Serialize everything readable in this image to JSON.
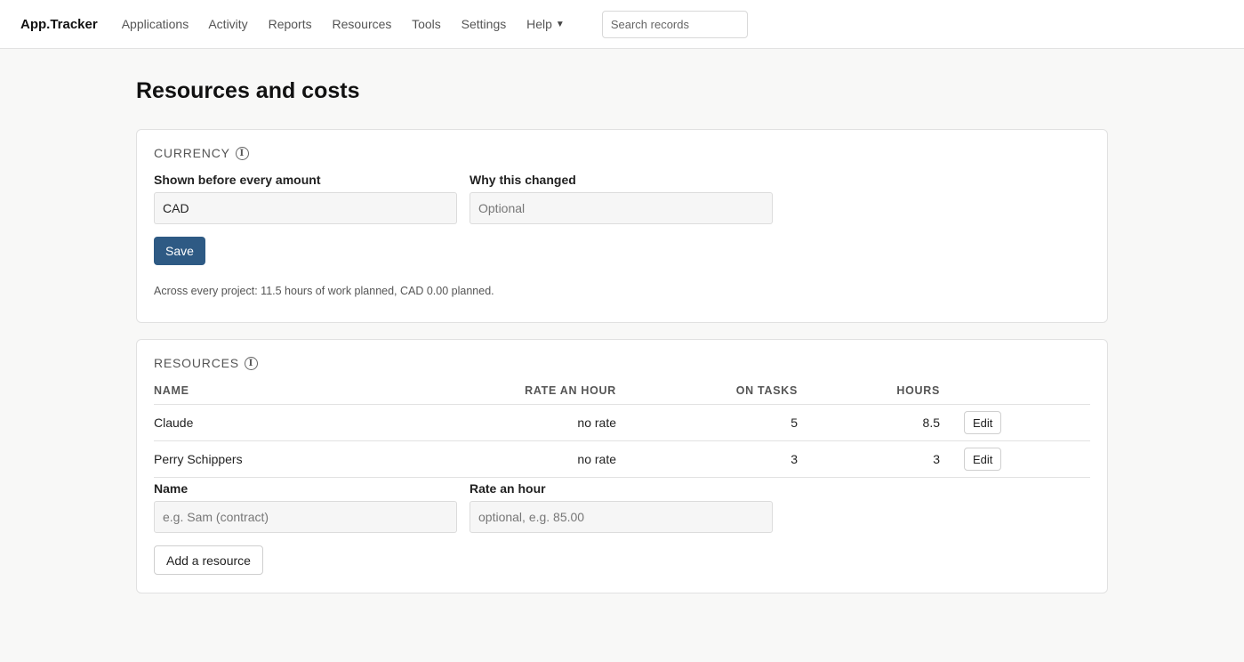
{
  "topbar": {
    "brand": "App.Tracker",
    "nav": [
      "Applications",
      "Activity",
      "Reports",
      "Resources",
      "Tools",
      "Settings"
    ],
    "help_label": "Help",
    "search_placeholder": "Search records"
  },
  "page": {
    "title": "Resources and costs"
  },
  "currency": {
    "heading": "CURRENCY",
    "shown_label": "Shown before every amount",
    "shown_value": "CAD",
    "why_label": "Why this changed",
    "why_placeholder": "Optional",
    "save_label": "Save",
    "summary": "Across every project: 11.5 hours of work planned, CAD 0.00 planned."
  },
  "resources": {
    "heading": "RESOURCES",
    "columns": {
      "name": "NAME",
      "rate": "RATE AN HOUR",
      "tasks": "ON TASKS",
      "hours": "HOURS"
    },
    "rows": [
      {
        "name": "Claude",
        "rate": "no rate",
        "tasks": "5",
        "hours": "8.5",
        "action": "Edit"
      },
      {
        "name": "Perry Schippers",
        "rate": "no rate",
        "tasks": "3",
        "hours": "3",
        "action": "Edit"
      }
    ],
    "form": {
      "name_label": "Name",
      "name_placeholder": "e.g. Sam (contract)",
      "rate_label": "Rate an hour",
      "rate_placeholder": "optional, e.g. 85.00",
      "add_label": "Add a resource"
    }
  }
}
